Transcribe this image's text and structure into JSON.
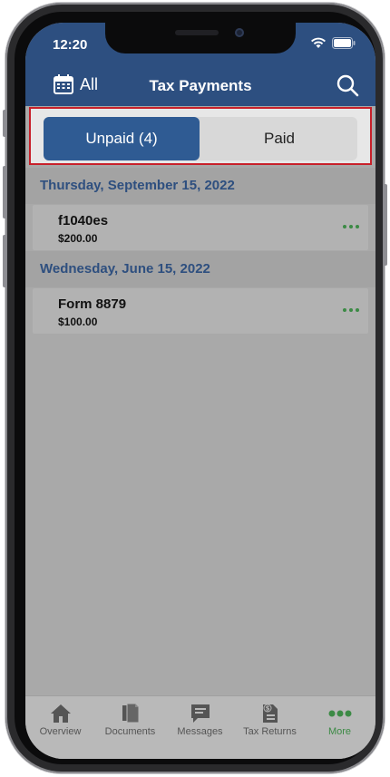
{
  "status_bar": {
    "time": "12:20"
  },
  "nav": {
    "all_label": "All",
    "title": "Tax Payments"
  },
  "segmented": {
    "unpaid_label": "Unpaid (4)",
    "paid_label": "Paid",
    "selected": "unpaid"
  },
  "sections": [
    {
      "date": "Thursday, September 15, 2022",
      "items": [
        {
          "name": "f1040es",
          "amount": "$200.00"
        }
      ]
    },
    {
      "date": "Wednesday, June 15, 2022",
      "items": [
        {
          "name": "Form 8879",
          "amount": "$100.00"
        }
      ]
    }
  ],
  "tabbar": {
    "tabs": [
      {
        "label": "Overview",
        "icon": "home-icon"
      },
      {
        "label": "Documents",
        "icon": "documents-icon"
      },
      {
        "label": "Messages",
        "icon": "messages-icon"
      },
      {
        "label": "Tax Returns",
        "icon": "tax-returns-icon"
      },
      {
        "label": "More",
        "icon": "more-icon"
      }
    ],
    "active": "More"
  },
  "colors": {
    "header": "#2d4f80",
    "accent": "#2f5b93",
    "more_green": "#3c8a45",
    "highlight_border": "#c8202a"
  }
}
